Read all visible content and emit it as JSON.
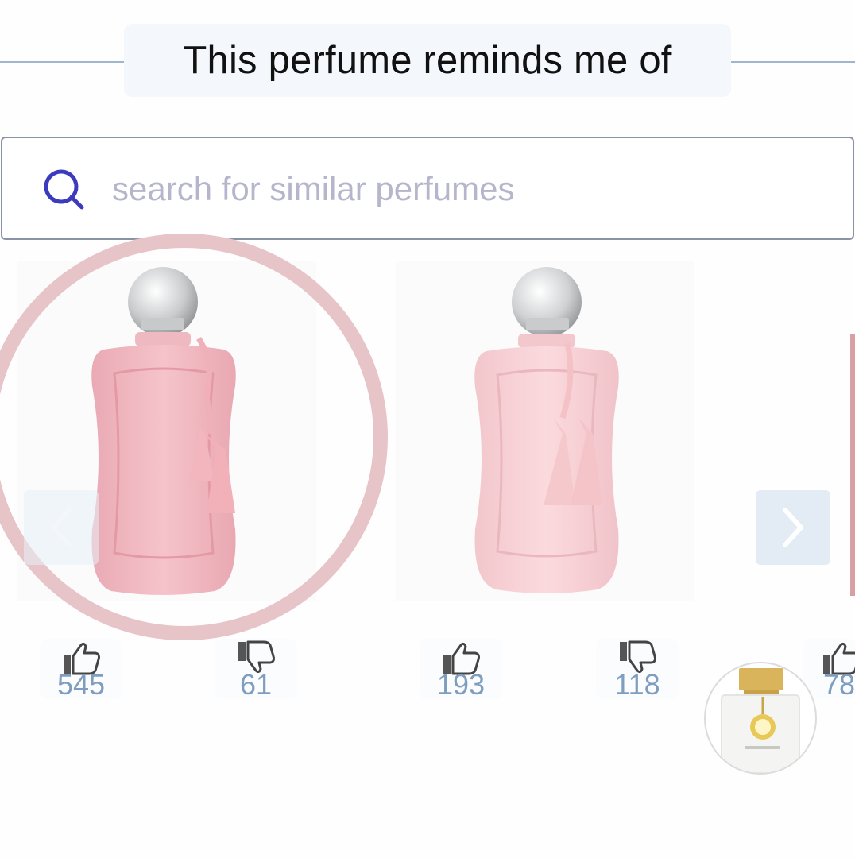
{
  "section": {
    "title": "This perfume reminds me of"
  },
  "search": {
    "placeholder": "search for similar perfumes",
    "icon": "search-icon"
  },
  "carousel": {
    "items": [
      {
        "name": "pink-perfume-bottle-1",
        "likes": "545",
        "dislikes": "61",
        "highlighted": true
      },
      {
        "name": "pink-perfume-bottle-2",
        "likes": "193",
        "dislikes": "118",
        "highlighted": false
      },
      {
        "name": "partial-perfume-3",
        "likes": "78"
      }
    ],
    "prev_icon": "chevron-left-icon",
    "next_icon": "chevron-right-icon"
  },
  "colors": {
    "accent_search_icon": "#3d3bbd",
    "count_text": "#7f9dbf",
    "highlight_ring": "#e6c4c8",
    "bottle_pink": "#f3c6cc"
  }
}
